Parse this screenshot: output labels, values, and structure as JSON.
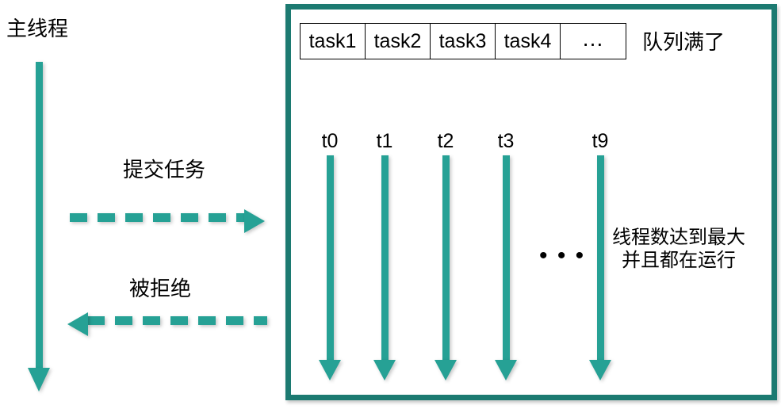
{
  "diagram": {
    "title_label": "主线程",
    "main_thread": {
      "label": "主线程",
      "arrow_icon": "down-arrow-icon"
    },
    "messages": [
      {
        "label": "提交任务",
        "direction": "right"
      },
      {
        "label": "被拒绝",
        "direction": "left"
      }
    ],
    "submit_message": "提交任务",
    "reject_message": "被拒绝",
    "queue": {
      "cells": [
        "task1",
        "task2",
        "task3",
        "task4",
        "…"
      ],
      "full_note": "队列满了"
    },
    "threads": {
      "names": [
        "t0",
        "t1",
        "t2",
        "t3",
        "t9"
      ],
      "ellipsis": "• • •",
      "note_line1": "线程数达到最大",
      "note_line2": "并且都在运行",
      "note": "线程数达到最大并且都在运行"
    },
    "colors": {
      "accent_teal": "#26A195",
      "panel_border": "#1C7A71",
      "text": "#000000",
      "background": "#FFFFFF"
    }
  }
}
